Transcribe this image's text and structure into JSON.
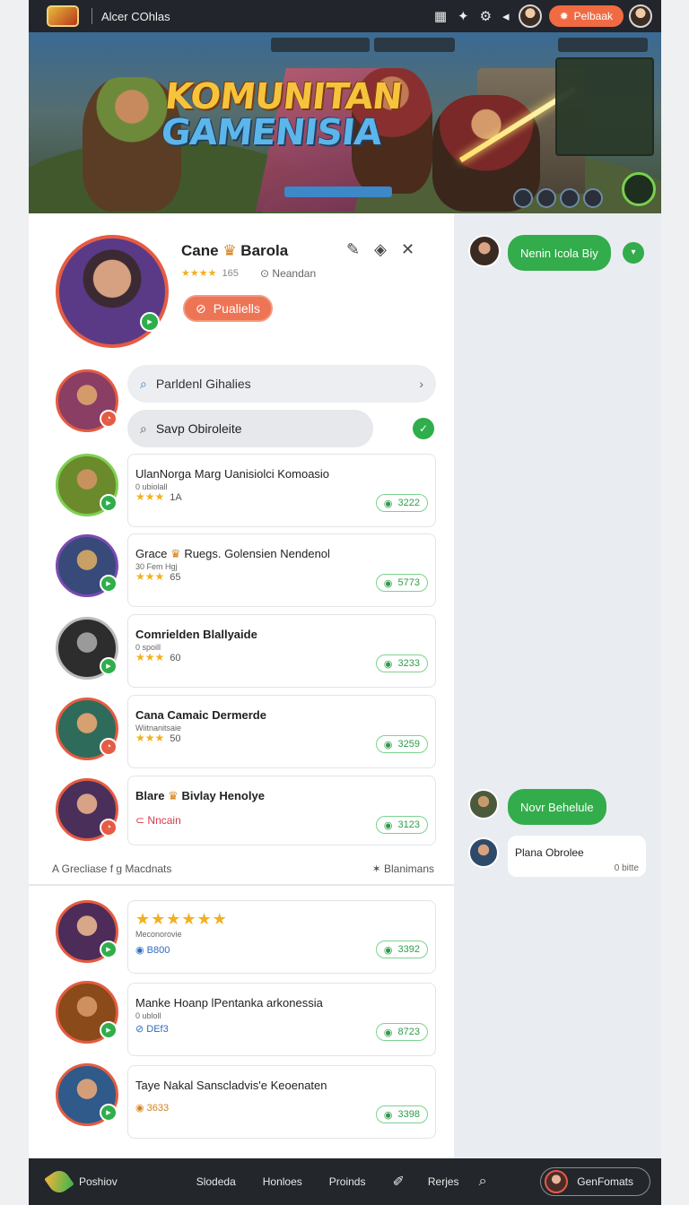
{
  "topbar": {
    "title": "Alcer COhlas",
    "pill_label": "Pelbaak",
    "icons": [
      "grid-icon",
      "rocket-icon",
      "bell-icon",
      "gear-icon",
      "chevron-left-icon"
    ]
  },
  "banner": {
    "title_line1": "KOMUNITAN",
    "title_line2": "GAMENISIA"
  },
  "profile": {
    "name": "Cane",
    "name_suffix": "Barola",
    "stars": "★★★★",
    "stars_count": "165",
    "location": "Neandan",
    "pill_label": "Pualiells"
  },
  "search": {
    "primary": "Parldenl Gihalies",
    "secondary": "Savp Obiroleite"
  },
  "list": [
    {
      "title": "UlanNorga Marg Uanisiolci Komoasio",
      "sub": "0 ubiolall",
      "stars": "★★★",
      "count": "1A",
      "badge": "3222"
    },
    {
      "title": "Grace",
      "title_rest": "Ruegs. Golensien Nendenol",
      "sub": "30 Fem Hgj",
      "stars": "★★★",
      "count": "65",
      "badge": "5773"
    },
    {
      "title": "Comrielden Blallyaide",
      "sub": "0 spoill",
      "stars": "★★★",
      "count": "60",
      "badge": "3233"
    },
    {
      "title": "Cana Camaic Dermerde",
      "sub": "Wiitnanitsaie",
      "stars": "★★★",
      "count": "50",
      "badge": "3259"
    },
    {
      "title": "Blare",
      "title_rest": "Bivlay Henolye",
      "status": "Nncain",
      "badge": "3123"
    }
  ],
  "section": {
    "left": "A Grecliase f g Macdnats",
    "right": "Blanimans"
  },
  "list2": [
    {
      "stars": "★★★★★★",
      "sub": "Meconorovie",
      "coin": "B800",
      "badge": "3392"
    },
    {
      "title": "Manke Hoanp lPentanka arkonessia",
      "sub": "0 ubloll",
      "coin": "DEf3",
      "badge": "8723"
    },
    {
      "title": "Taye Nakal Sanscladvis'e Keoenaten",
      "coin": "3633",
      "badge": "3398"
    }
  ],
  "chat": {
    "bubble1": "Nenin Icola Biy",
    "bubble2": "Novr Behelule",
    "bubble3_text": "Plana Obrolee",
    "bubble3_meta": "0 bitte"
  },
  "bottombar": {
    "brand": "Poshiov",
    "nav": [
      "Slodeda",
      "Honloes",
      "Proinds",
      "Rerjes"
    ],
    "button": "GenFomats"
  },
  "colors": {
    "accent_green": "#33ac4c",
    "accent_orange": "#f06b43",
    "star_gold": "#f2b01e",
    "dark_bar": "#23262b"
  }
}
